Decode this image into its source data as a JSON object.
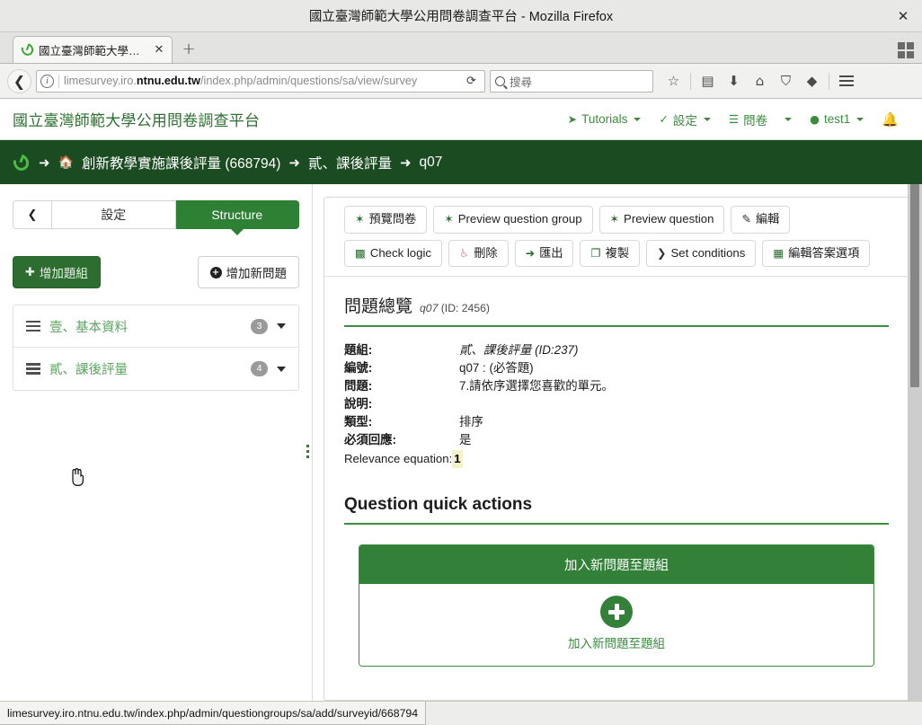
{
  "browser": {
    "window_title": "國立臺灣師範大學公用問卷調查平台 - Mozilla Firefox",
    "close_label": "✕",
    "tab": {
      "title": "國立臺灣師範大學公...",
      "close_label": "✕",
      "favicon": "limesurvey-lime-icon"
    },
    "newtab_label": "+",
    "back_label": "❮",
    "url_prefix": "limesurvey.iro.",
    "url_domain": "ntnu.edu.tw",
    "url_suffix": "/index.php/admin/questions/sa/view/survey",
    "reload_label": "⟳",
    "search_placeholder": "搜尋",
    "icons": {
      "bookmark": "☆",
      "library": "▤",
      "download": "⬇",
      "home": "⌂",
      "pocket": "⛉",
      "sync": "◆"
    }
  },
  "header": {
    "brand": "國立臺灣師範大學公用問卷調查平台",
    "nav": [
      {
        "label": "Tutorials",
        "icon": "rocket-icon",
        "glyph": "➤",
        "caret": true
      },
      {
        "label": "設定",
        "icon": "wrench-icon",
        "glyph": "🔧",
        "caret": true
      },
      {
        "label": "問卷",
        "icon": "list-icon",
        "glyph": "☰",
        "caret": true
      },
      {
        "label": "test1",
        "icon": "user-icon",
        "glyph": "👤",
        "caret": true
      }
    ],
    "bell_icon": "bell-icon",
    "bell_glyph": "🔔"
  },
  "breadcrumb": {
    "logo": "limesurvey-logo",
    "arrow": "➜",
    "home_glyph": "⌂",
    "items": [
      "創新教學實施課後評量 (668794)",
      "貳、課後評量",
      "q07"
    ]
  },
  "sidebar": {
    "back_label": "❮",
    "tabs": [
      {
        "label": "設定",
        "active": false
      },
      {
        "label": "Structure",
        "active": true
      }
    ],
    "add_group_label": "增加題組",
    "add_group_icon": "plus-icon",
    "add_question_label": "增加新問題",
    "add_question_icon": "circle-plus-icon",
    "groups": [
      {
        "name": "壹、基本資料",
        "count": "3"
      },
      {
        "name": "貳、課後評量",
        "count": "4"
      }
    ]
  },
  "toolbar": {
    "row1": [
      {
        "label": "預覽問卷",
        "icon": "gear-icon",
        "glyph": "✿"
      },
      {
        "label": "Preview question group",
        "icon": "gear-icon",
        "glyph": "✿"
      },
      {
        "label": "Preview question",
        "icon": "gear-icon",
        "glyph": "✿"
      },
      {
        "label": "編輯",
        "icon": "pencil-icon",
        "glyph": "✎"
      }
    ],
    "row2": [
      {
        "label": "Check logic",
        "icon": "logic-icon",
        "glyph": "▩"
      },
      {
        "label": "刪除",
        "icon": "trash-icon",
        "glyph": "🗑"
      },
      {
        "label": "匯出",
        "icon": "export-icon",
        "glyph": "⤓"
      },
      {
        "label": "複製",
        "icon": "copy-icon",
        "glyph": "❐"
      },
      {
        "label": "Set conditions",
        "icon": "conditions-icon",
        "glyph": "⋏"
      },
      {
        "label": "編輯答案選項",
        "icon": "table-icon",
        "glyph": "▦"
      }
    ]
  },
  "overview": {
    "title": "問題總覽",
    "subtitle_code": "q07",
    "subtitle_id": "(ID: 2456)",
    "rows": [
      {
        "key": "題組:",
        "value": "貳、課後評量 (ID:237)",
        "italic": true
      },
      {
        "key": "編號:",
        "value": "q07 : (必答題)",
        "italic": false
      },
      {
        "key": "問題:",
        "value": "7.請依序選擇您喜歡的單元。",
        "italic": false
      },
      {
        "key": "說明:",
        "value": "",
        "italic": false
      },
      {
        "key": "類型:",
        "value": "排序",
        "italic": false
      },
      {
        "key": "必須回應:",
        "value": "是",
        "italic": false
      }
    ],
    "relevance_key": "Relevance equation:",
    "relevance_value": "1"
  },
  "quick_actions": {
    "title": "Question quick actions",
    "card_header": "加入新問題至題組",
    "card_link": "加入新問題至題組",
    "plus_icon": "plus-circle-icon"
  },
  "status": {
    "url": "limesurvey.iro.ntnu.edu.tw/index.php/admin/questiongroups/sa/add/surveyid/668794"
  },
  "colors": {
    "brand_green": "#2e8034",
    "dark_green": "#1b4b20",
    "link_green": "#3d8b41",
    "badge_gray": "#9a9a9a",
    "highlight_yellow": "#f5f1c8"
  }
}
